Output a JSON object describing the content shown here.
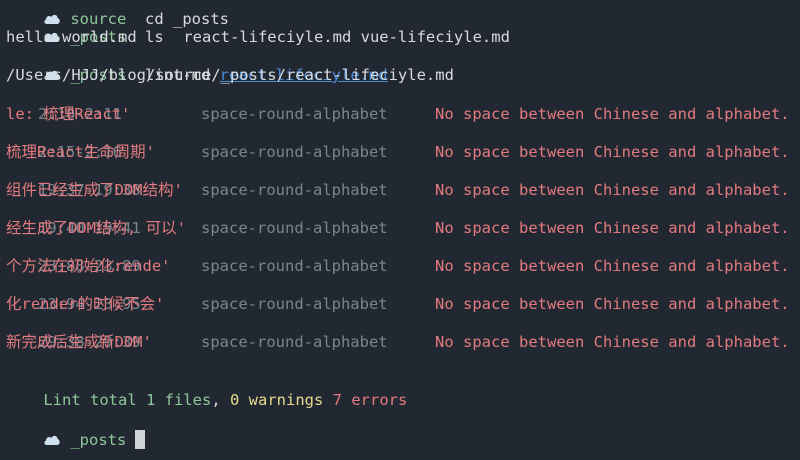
{
  "colors": {
    "background": "#222831",
    "text": "#d7dade",
    "prompt_green": "#8fc79a",
    "dim_grey": "#7c848d",
    "error_red": "#e27a7f",
    "warning_yellow": "#e6d98f",
    "link_blue": "#4a8ddb"
  },
  "prompt_icon": "cloud-icon",
  "history": {
    "cd": {
      "dir": "source",
      "command": "cd _posts"
    },
    "ls": {
      "dir": "_posts",
      "command": "ls",
      "output": "hello-world.md     react-lifeciyle.md vue-lifeciyle.md"
    },
    "lint": {
      "dir": "_posts",
      "command": "lint-md",
      "argument": "react-lifeciyle.md",
      "file_path": "/Users/HJJ/blog/source/_posts/react-lifeciyle.md"
    }
  },
  "lint_results": [
    {
      "position": "2:10-2:11",
      "rule": "space-round-alphabet",
      "message": "No space between Chinese and alphabet. 't",
      "continuation": "le: 梳理React'"
    },
    {
      "position": "2:15-2:16",
      "rule": "space-round-alphabet",
      "message": "No space between Chinese and alphabet. '",
      "continuation": "梳理React生命周期'"
    },
    {
      "position": "19:37-19:38",
      "rule": "space-round-alphabet",
      "message": "No space between Chinese and alphabet. '",
      "continuation": "组件已经生成了DOM结构'"
    },
    {
      "position": "19:40-19:41",
      "rule": "space-round-alphabet",
      "message": "No space between Chinese and alphabet. '",
      "continuation": "经生成了DOM结构, 可以'"
    },
    {
      "position": "23:88-23:89",
      "rule": "space-round-alphabet",
      "message": "No space between Chinese and alphabet. '",
      "continuation": "个方法在初始化rende'"
    },
    {
      "position": "23:94-23:95",
      "rule": "space-round-alphabet",
      "message": "No space between Chinese and alphabet. '",
      "continuation": "化render的时候不会'"
    },
    {
      "position": "29:38-29:39",
      "rule": "space-round-alphabet",
      "message": "No space between Chinese and alphabet. '",
      "continuation": "新完成后生成新DOM'"
    }
  ],
  "summary": {
    "prefix": "Lint total 1 files",
    "comma": ",",
    "warnings": "0 warnings",
    "errors": "7 errors"
  },
  "current_prompt": {
    "dir": "_posts"
  }
}
